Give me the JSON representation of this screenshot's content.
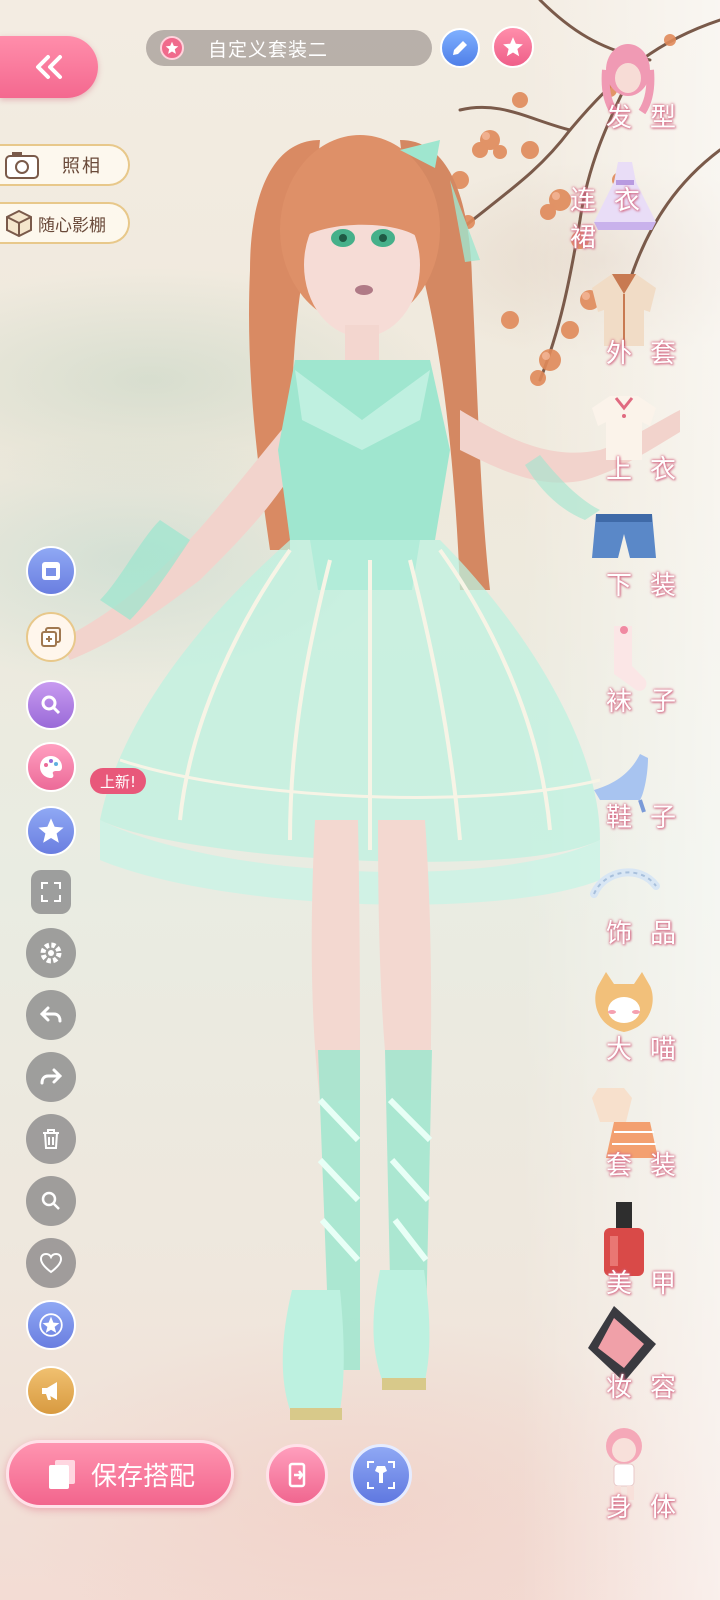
{
  "header": {
    "title": "自定义套装二",
    "back_icon": "double-chevron-left-icon",
    "edit_icon": "pencil-icon",
    "favorite_icon": "star-icon"
  },
  "left_panel": {
    "photo_label": "照相",
    "studio_label": "随心影棚",
    "new_badge": "上新!"
  },
  "categories": [
    {
      "label": "发型",
      "icon": "hair-icon"
    },
    {
      "label": "连衣裙",
      "icon": "dress-icon"
    },
    {
      "label": "外套",
      "icon": "coat-icon"
    },
    {
      "label": "上衣",
      "icon": "top-icon"
    },
    {
      "label": "下装",
      "icon": "bottoms-icon"
    },
    {
      "label": "袜子",
      "icon": "socks-icon"
    },
    {
      "label": "鞋子",
      "icon": "shoes-icon"
    },
    {
      "label": "饰品",
      "icon": "accessory-icon"
    },
    {
      "label": "大喵",
      "icon": "cat-icon"
    },
    {
      "label": "套装",
      "icon": "outfit-set-icon"
    },
    {
      "label": "美甲",
      "icon": "nail-polish-icon"
    },
    {
      "label": "妆容",
      "icon": "makeup-icon"
    },
    {
      "label": "身体",
      "icon": "body-icon"
    }
  ],
  "bottom_bar": {
    "save_label": "保存搭配"
  },
  "colors": {
    "accent_pink": "#f2658d",
    "dress_mint": "#9fe6cf",
    "hair": "#d98a63"
  }
}
